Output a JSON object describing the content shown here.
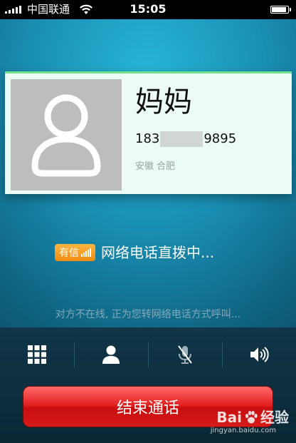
{
  "status_bar": {
    "carrier": "中国联通",
    "time": "15:05"
  },
  "contact": {
    "name": "妈妈",
    "number_prefix": "183",
    "number_suffix": "9895",
    "location": "安徽 合肥"
  },
  "call": {
    "service_badge": "有信",
    "status": "网络电话直拨中...",
    "message": "对方不在线, 正为您转网络电话方式呼叫..."
  },
  "controls": [
    {
      "icon": "keypad-icon"
    },
    {
      "icon": "contact-icon"
    },
    {
      "icon": "mute-icon"
    },
    {
      "icon": "speaker-icon"
    }
  ],
  "end_call_label": "结束通话",
  "watermark": {
    "brand": "Bai",
    "brand_suffix": "经验",
    "url": "jingyan.baidu.com"
  },
  "colors": {
    "background": "#1a8fb3",
    "card_background": "#ecfbf6",
    "card_accent": "#6fe08b",
    "badge": "#f08b10",
    "end_call": "#e21d1d"
  }
}
